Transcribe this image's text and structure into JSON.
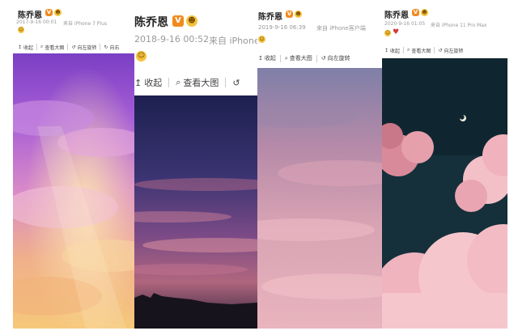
{
  "posts": [
    {
      "author": "陈乔恩",
      "badge": "V",
      "emoji": "ʖ",
      "reaction_emoji": "☺",
      "timestamp": "2017-9-16 00:01",
      "source": "来自 iPhone 7 Plus",
      "tools": [
        "收起",
        "查看大图",
        "向左旋转",
        "向右"
      ]
    },
    {
      "author": "陈乔恩",
      "badge": "V",
      "emoji": "ʖ",
      "reaction_emoji": "☺",
      "timestamp": "2018-9-16 00:52",
      "source": "来自 iPhone",
      "tools": [
        "收起",
        "查看大图"
      ]
    },
    {
      "author": "陈乔恩",
      "badge": "V",
      "emoji": "ʖ",
      "reaction_emoji": "☺",
      "timestamp": "2019-9-16 06:39",
      "source": "来自 iPhone客户端",
      "tools": [
        "收起",
        "查看大图",
        "向左旋转"
      ]
    },
    {
      "author": "陈乔恩",
      "badge": "V",
      "emoji": "ʖ",
      "reaction_emoji": "☺",
      "timestamp": "2020-9-16 01:05",
      "source": "来自 iPhone 11 Pro Max",
      "tools": [
        "收起",
        "查看大图",
        "向左旋转"
      ]
    }
  ],
  "colors": {
    "badge": "#f28a1e",
    "meta_text": "#999999",
    "sky_purple": "#9a5fd0",
    "sky_dusk": "#3a3060",
    "sky_pink": "#c99ab0",
    "sky_teal": "#17353f"
  },
  "icons": [
    "collapse-icon",
    "zoom-icon",
    "rotate-left-icon",
    "rotate-right-icon"
  ]
}
